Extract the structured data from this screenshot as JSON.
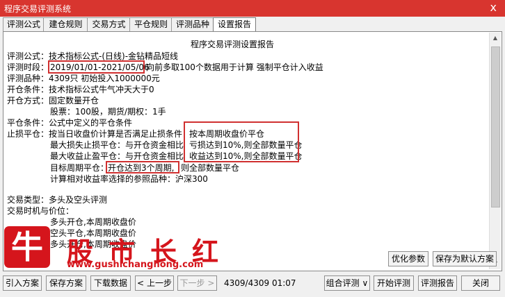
{
  "window": {
    "title": "程序交易评测系统",
    "close_glyph": "x"
  },
  "tabs": [
    "评测公式",
    "建仓规则",
    "交易方式",
    "平仓规则",
    "评测品种",
    "设置报告"
  ],
  "active_tab_index": 5,
  "report": {
    "heading": "程序交易评测设置报告",
    "formula_label": "评测公式：",
    "formula_value": "技术指标公式-(日线)-金钻精品短线",
    "period_label": "评测时段：",
    "period_dates": "2019/01/01-2021/05/06",
    "period_rest": "向前多取100个数据用于计算 强制平仓计入收益",
    "variety": "评测品种：4309只 初始投入1000000元",
    "open_cond": "开仓条件：技术指标公式牛气冲天大于0",
    "open_method": "开仓方式：固定数量开仓",
    "open_qty": "股票：100股，期货/期权：1手",
    "close_cond": "平仓条件：公式中定义的平仓条件",
    "stoploss_prefix": "止损平仓：按当日收盘价计算是否满足止损条件",
    "stoploss_suffix": "按本周期收盘价平仓",
    "max_loss_prefix": "最大损失止损平仓：与开仓资金相比",
    "max_loss_suffix": "亏损达到10%,则全部数量平仓",
    "max_gain_prefix": "最大收益止盈平仓：与开仓资金相比",
    "max_gain_suffix": "收益达到10%,则全部数量平仓",
    "target_label": "目标周期平仓：",
    "target_mid": "开仓达到3个周期,",
    "target_rest": "则全部数量平仓",
    "benchmark": "计算相对收益率选择的参照品种：沪深300",
    "trade_type": "交易类型：多头及空头评测",
    "trade_time": "交易时机与价位：",
    "long_open": "多头开仓,本周期收盘价",
    "short_open": "空头平仓,本周期收盘价",
    "long_close": "多头开仓,本周期收盘价"
  },
  "buttons": {
    "optimize": "优化参数",
    "save_default": "保存为默认方案",
    "import": "引入方案",
    "save_scheme": "保存方案",
    "download": "下载数据",
    "prev": "上一步",
    "next": "下一步",
    "combo_eval": "组合评测",
    "start_eval": "开始评测",
    "eval_report": "评测报告",
    "close": "关闭"
  },
  "status": {
    "progress": "4309/4309",
    "time": "01:07"
  },
  "watermark": {
    "logo_char": "牛",
    "title": "股市长红",
    "url": "www.gushichanghong.com"
  },
  "colors": {
    "titlebar": "#d8352f",
    "highlight_box": "#d03030",
    "watermark": "#d5151c"
  }
}
